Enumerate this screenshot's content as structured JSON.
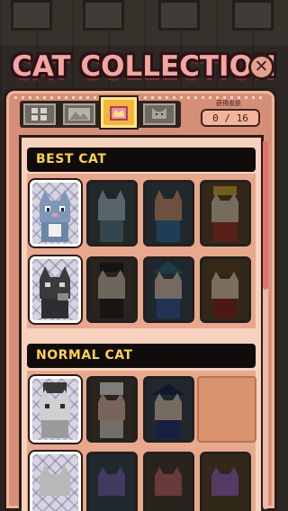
{
  "title": "CAT COLLECTION",
  "close_icon": "close-icon",
  "tabs": [
    {
      "name": "grid-view-icon",
      "active": false
    },
    {
      "name": "landscape-icon",
      "active": false
    },
    {
      "name": "crown-icon",
      "active": true
    },
    {
      "name": "cat-face-icon",
      "active": false
    }
  ],
  "skin_counter": {
    "label": "获得皮肤",
    "value": "0 / 16"
  },
  "sections": [
    {
      "title": "BEST CAT"
    },
    {
      "title": "NORMAL CAT"
    }
  ],
  "colors": {
    "frame": "#d68f77",
    "panel": "#f6d2bf",
    "header_text": "#ffd24a",
    "title_pink": "#f5a5a0",
    "active_tab": "#f7b33c"
  }
}
